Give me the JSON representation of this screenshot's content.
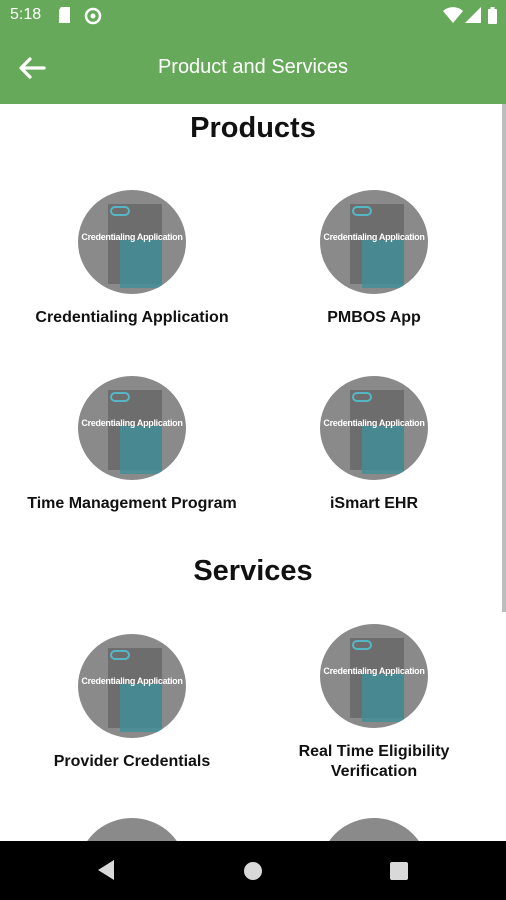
{
  "status_bar": {
    "time": "5:18"
  },
  "app_bar": {
    "title": "Product and Services",
    "back_icon": "arrow-left-icon"
  },
  "products": {
    "heading": "Products",
    "items": [
      {
        "label": "Credentialing Application",
        "thumb_caption": "Credentialing Application"
      },
      {
        "label": "PMBOS App",
        "thumb_caption": "Credentialing Application"
      },
      {
        "label": "Time Management Program",
        "thumb_caption": "Credentialing Application"
      },
      {
        "label": "iSmart EHR",
        "thumb_caption": "Credentialing Application"
      }
    ]
  },
  "services": {
    "heading": "Services",
    "items": [
      {
        "label": "Provider Credentials",
        "thumb_caption": "Credentialing Application"
      },
      {
        "label_line1": "Real Time Eligibility",
        "label_line2": "Verification",
        "thumb_caption": "Credentialing Application"
      }
    ]
  },
  "nav_bar": {
    "icons": [
      "back-triangle-icon",
      "home-circle-icon",
      "recents-square-icon"
    ]
  },
  "colors": {
    "accent": "#67a95a",
    "nav_bg": "#000000"
  }
}
